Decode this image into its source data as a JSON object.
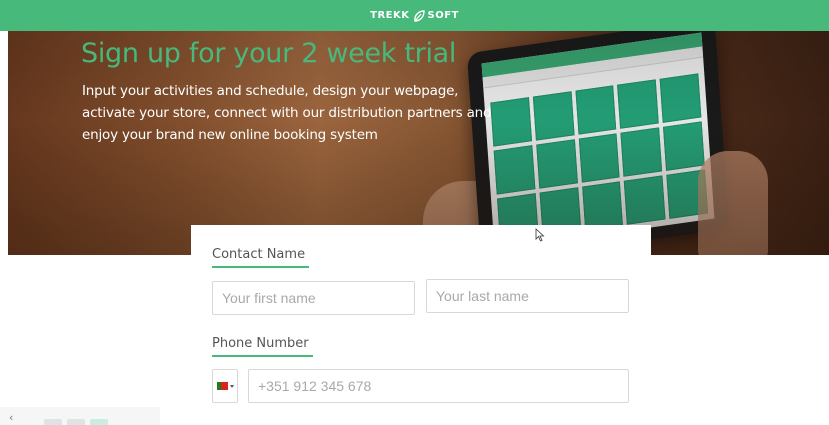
{
  "brand": {
    "name_left": "TREKK",
    "name_right": "SOFT",
    "accent": "#46b97b"
  },
  "hero": {
    "title": "Sign up for your 2 week trial",
    "description": "Input your activities and schedule, design your webpage, activate your store, connect with our distribution partners and enjoy your brand new online booking system"
  },
  "form": {
    "contact_label": "Contact Name",
    "first_name_placeholder": "Your first name",
    "last_name_placeholder": "Your last name",
    "phone_label": "Phone Number",
    "phone_placeholder": "+351 912 345 678",
    "country_flag": "portugal-flag-icon"
  },
  "nav": {
    "back_symbol": "‹"
  }
}
